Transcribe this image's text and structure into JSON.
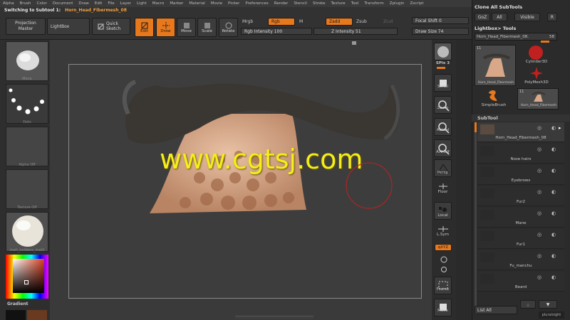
{
  "menu": [
    "Alpha",
    "Brush",
    "Color",
    "Document",
    "Draw",
    "Edit",
    "File",
    "Layer",
    "Light",
    "Macro",
    "Marker",
    "Material",
    "Movie",
    "Picker",
    "Preferences",
    "Render",
    "Stencil",
    "Stroke",
    "Texture",
    "Tool",
    "Transform",
    "Zplugin",
    "Zscript"
  ],
  "status": {
    "prefix": "Switching to Subtool 1:",
    "name": "Horn_Head_Fibermesh_08"
  },
  "shelf": {
    "projection_master": "Projection Master",
    "lightbox": "LightBox",
    "quick_sketch": "Quick Sketch",
    "edit": "Edit",
    "draw": "Draw",
    "move": "Move",
    "scale": "Scale",
    "rotate": "Rotate",
    "mrgb": "Mrgb",
    "rgb": "Rgb",
    "m": "M",
    "zadd": "Zadd",
    "zsub": "Zsub",
    "zcut": "Zcut",
    "rgb_intensity": "Rgb Intensity 100",
    "z_intensity": "Z Intensity 51",
    "focal_shift": "Focal Shift 0",
    "draw_size": "Draw Size 74"
  },
  "left": {
    "move": "Move",
    "dots": "Dots",
    "alpha_off": "Alpha Off",
    "texture_off": "Texture Off",
    "material": "mah_noldens_matli",
    "gradient": "Gradient"
  },
  "watermark": "www.cgtsj.com",
  "right_shelf": {
    "bpr": "BPR",
    "spix": "SPix 3",
    "scroll": "Scroll",
    "zoom": "Zoom",
    "actual": "Actual",
    "aahalf": "AAHalf",
    "persp": "Persp",
    "floor": "Floor",
    "local": "Local",
    "lsym": "L.Sym",
    "xyz": "qXYZ",
    "frame": "Frame",
    "move": "Move"
  },
  "right_panel": {
    "clone": "Clone All SubTools",
    "goz": "GoZ",
    "all": "All",
    "visible": "Visible",
    "r": "R",
    "lightbox_tools": "Lightbox> Tools",
    "tool_name": "Horn_Head_Fibermesh_08.",
    "tool_count": "58",
    "thumb1_label": "Horn_Head_Fibermesh",
    "cylinder": "Cylinder3D",
    "polymesh": "PolyMesh3D",
    "simplebrush": "SimpleBrush",
    "thumb2_label": "Horn_Head_Fibermesh",
    "thumb2_count": "11",
    "thumb1_count": "11",
    "subtool": "SubTool",
    "subtools": [
      "Horn_Head_Fibermesh_08",
      "Nose hairs",
      "Eyebrows",
      "Fur2",
      "Mane",
      "Fur1",
      "Fu_manchu",
      "Beard"
    ],
    "list_all": "List All"
  },
  "corner_badge": "pluralsight"
}
